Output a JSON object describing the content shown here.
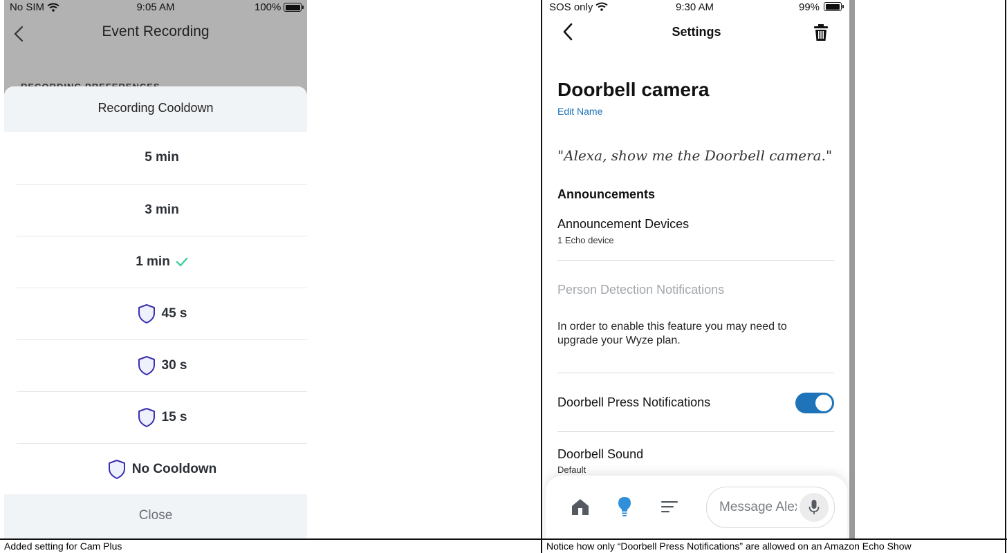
{
  "left": {
    "status": {
      "carrier": "No SIM",
      "time": "9:05 AM",
      "battery": "100%"
    },
    "nav_title": "Event Recording",
    "section_label": "RECORDING PREFERENCES",
    "sheet": {
      "title": "Recording Cooldown",
      "options": [
        {
          "label": "5 min",
          "locked": false,
          "selected": false
        },
        {
          "label": "3 min",
          "locked": false,
          "selected": false
        },
        {
          "label": "1 min",
          "locked": false,
          "selected": true
        },
        {
          "label": "45 s",
          "locked": true,
          "selected": false
        },
        {
          "label": "30 s",
          "locked": true,
          "selected": false
        },
        {
          "label": "15 s",
          "locked": true,
          "selected": false
        },
        {
          "label": "No Cooldown",
          "locked": true,
          "selected": false
        }
      ],
      "close_label": "Close"
    },
    "caption": "Added setting for Cam Plus"
  },
  "right": {
    "status": {
      "carrier": "SOS only",
      "time": "9:30 AM",
      "battery": "99%"
    },
    "nav_title": "Settings",
    "device_name": "Doorbell camera",
    "edit_name": "Edit Name",
    "alexa_phrase": "\"Alexa, show me the Doorbell camera.\"",
    "announcements_heading": "Announcements",
    "announcement_devices": {
      "label": "Announcement Devices",
      "sub": "1 Echo device"
    },
    "person_detection": "Person Detection Notifications",
    "upgrade_note": "In order to enable this feature you may need to upgrade your Wyze plan.",
    "doorbell_press": {
      "label": "Doorbell Press Notifications",
      "enabled": true
    },
    "doorbell_sound": {
      "label": "Doorbell Sound",
      "sub": "Default"
    },
    "message_placeholder": "Message Alexa",
    "caption": "Notice how only “Doorbell Press Notifications” are allowed on an Amazon Echo Show"
  },
  "colors": {
    "accent_blue": "#1f73b8",
    "check_green": "#3ccf9a",
    "shield_stroke": "#3a2fb0",
    "shield_fill": "#eef0fb"
  }
}
